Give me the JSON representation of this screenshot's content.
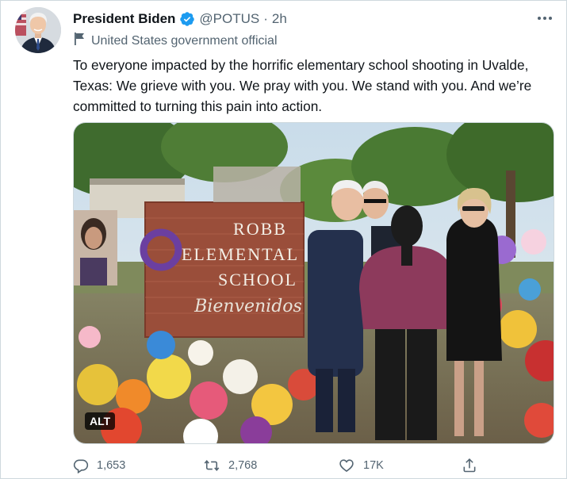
{
  "tweet": {
    "display_name": "President Biden",
    "handle": "@POTUS",
    "separator": "·",
    "time": "2h",
    "account_label": "United States government official",
    "text": "To everyone impacted by the horrific elementary school shooting in Uvalde,\nTexas: We grieve with you. We pray with you. We stand with you. And we’re\ncommitted to turning this pain into action."
  },
  "media": {
    "sign_line1": "ROBB",
    "sign_line2": "ELEMENTAL",
    "sign_line3": "SCHOOL",
    "sign_line4": "Bienvenidos",
    "alt_badge": "ALT"
  },
  "actions": {
    "replies": "1,653",
    "retweets": "2,768",
    "likes": "17K"
  },
  "colors": {
    "verified_blue": "#1d9bf0",
    "text": "#0f1419",
    "secondary": "#536471",
    "border": "#cfd9de"
  }
}
